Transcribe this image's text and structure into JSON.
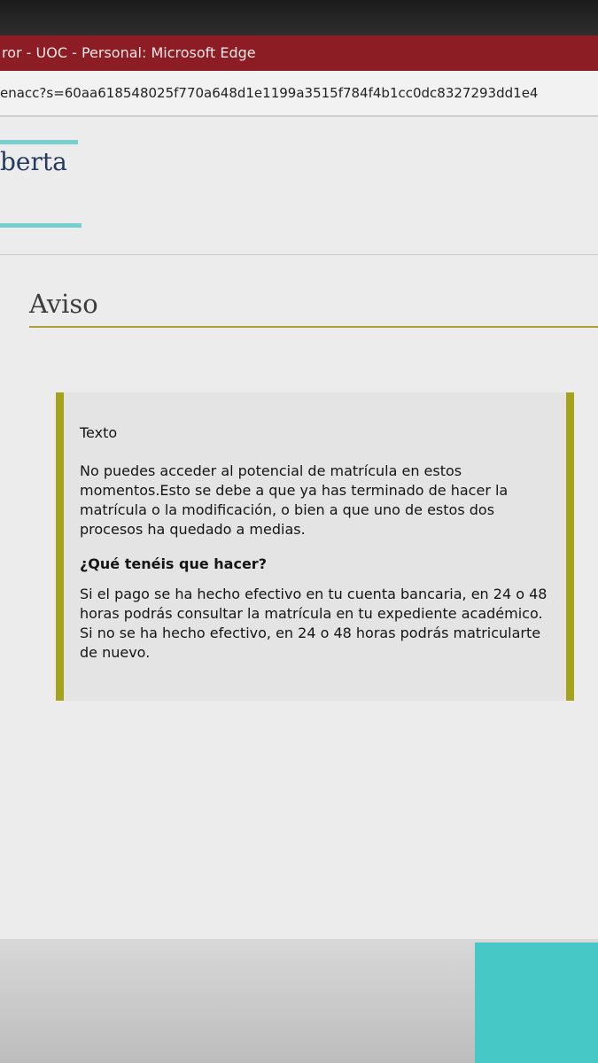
{
  "window": {
    "title": "ror - UOC - Personal: Microsoft Edge"
  },
  "address_bar": {
    "url": "enacc?s=60aa618548025f770a648d1e1199a3515f784f4b1cc0dc8327293dd1e4"
  },
  "header": {
    "brand_text": "berta",
    "accent_color": "#77cfd0"
  },
  "page": {
    "title": "Aviso"
  },
  "notice": {
    "heading": "Texto",
    "body": "No puedes acceder al potencial de matrícula en estos momentos.Esto se debe a que ya has terminado de hacer la matrícula o la modificación, o bien a que uno de estos dos procesos ha quedado a medias.",
    "subheading": "¿Qué tenéis que hacer?",
    "instructions": "Si el pago se ha hecho efectivo en tu cuenta bancaria, en 24 o 48 horas podrás consultar la matrícula en tu expediente académico. Si no se ha hecho efectivo, en 24 o 48 horas podrás matricularte de nuevo.",
    "border_color": "#a7a21c"
  }
}
